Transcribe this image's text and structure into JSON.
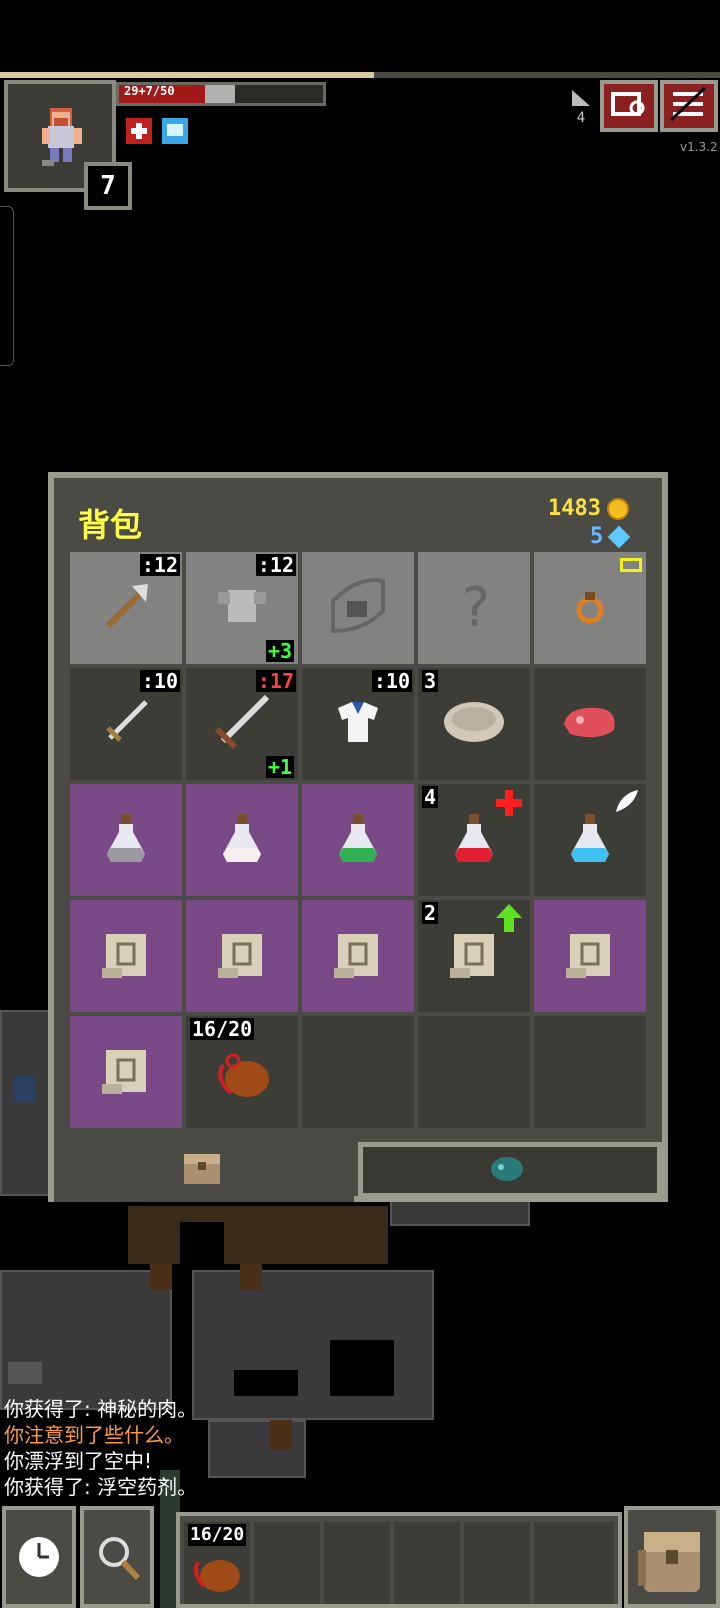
{
  "hud": {
    "hp_text": "29+7/50",
    "hero_level": "7",
    "depth": "4",
    "version": "v1.3.2",
    "experience_fraction": 0.52,
    "hp_fraction": 0.58,
    "shield_fraction": 0.14
  },
  "backpack": {
    "title": "背包",
    "gold": "1483",
    "gems": "5",
    "slots": [
      {
        "name": "axe",
        "level": ":12",
        "bonus": "",
        "qty": "",
        "bg": "light",
        "icon": "axe-icon"
      },
      {
        "name": "chain-armor",
        "level": ":12",
        "bonus": "+3",
        "qty": "",
        "bg": "light",
        "icon": "armor-icon"
      },
      {
        "name": "empty-artifact-slot",
        "level": "",
        "bonus": "",
        "qty": "",
        "bg": "light",
        "icon": "artifact-placeholder-icon"
      },
      {
        "name": "empty-misc-slot",
        "level": "",
        "bonus": "",
        "qty": "",
        "bg": "light",
        "icon": "question-icon"
      },
      {
        "name": "ring",
        "level": "",
        "bonus": "",
        "qty": "",
        "bg": "light",
        "icon": "ring-icon"
      },
      {
        "name": "dagger",
        "level": ":10",
        "bonus": "",
        "qty": "",
        "bg": "dark",
        "icon": "dagger-icon"
      },
      {
        "name": "sword",
        "level": ":17",
        "bonus": "+1",
        "qty": "",
        "bg": "dark",
        "icon": "sword-icon",
        "level_red": true
      },
      {
        "name": "cloth-armor",
        "level": ":10",
        "bonus": "",
        "qty": "",
        "bg": "dark",
        "icon": "shirt-icon"
      },
      {
        "name": "stone",
        "level": "",
        "bonus": "",
        "qty": "3",
        "bg": "dark",
        "icon": "stone-icon"
      },
      {
        "name": "meat",
        "level": "",
        "bonus": "",
        "qty": "",
        "bg": "dark",
        "icon": "meat-icon"
      },
      {
        "name": "potion-grey",
        "level": "",
        "bonus": "",
        "qty": "",
        "bg": "purple",
        "icon": "potion-grey-icon"
      },
      {
        "name": "potion-white",
        "level": "",
        "bonus": "",
        "qty": "",
        "bg": "purple",
        "icon": "potion-white-icon"
      },
      {
        "name": "potion-green",
        "level": "",
        "bonus": "",
        "qty": "",
        "bg": "purple",
        "icon": "potion-green-icon"
      },
      {
        "name": "potion-healing",
        "level": "",
        "bonus": "",
        "qty": "4",
        "bg": "dark",
        "icon": "potion-red-icon"
      },
      {
        "name": "potion-levitation",
        "level": "",
        "bonus": "",
        "qty": "",
        "bg": "dark",
        "icon": "potion-cyan-icon"
      },
      {
        "name": "scroll-1",
        "level": "",
        "bonus": "",
        "qty": "",
        "bg": "purple",
        "icon": "scroll-icon"
      },
      {
        "name": "scroll-2",
        "level": "",
        "bonus": "",
        "qty": "",
        "bg": "purple",
        "icon": "scroll-icon"
      },
      {
        "name": "scroll-3",
        "level": "",
        "bonus": "",
        "qty": "",
        "bg": "purple",
        "icon": "scroll-icon"
      },
      {
        "name": "scroll-upgrade",
        "level": "",
        "bonus": "",
        "qty": "2",
        "bg": "dark",
        "icon": "scroll-icon"
      },
      {
        "name": "scroll-5",
        "level": "",
        "bonus": "",
        "qty": "",
        "bg": "purple",
        "icon": "scroll-icon"
      },
      {
        "name": "scroll-6",
        "level": "",
        "bonus": "",
        "qty": "",
        "bg": "purple",
        "icon": "scroll-icon"
      },
      {
        "name": "waterskin",
        "level": "",
        "bonus": "",
        "qty": "16/20",
        "bg": "dark",
        "icon": "waterskin-icon"
      },
      {
        "name": "empty-1",
        "level": "",
        "bonus": "",
        "qty": "",
        "bg": "dark",
        "icon": ""
      },
      {
        "name": "empty-2",
        "level": "",
        "bonus": "",
        "qty": "",
        "bg": "dark",
        "icon": ""
      },
      {
        "name": "empty-3",
        "level": "",
        "bonus": "",
        "qty": "",
        "bg": "dark",
        "icon": ""
      }
    ]
  },
  "log": [
    {
      "text": "你获得了: 神秘的肉。",
      "type": "normal"
    },
    {
      "text": "你注意到了些什么。",
      "type": "warn"
    },
    {
      "text": "你漂浮到了空中!",
      "type": "normal"
    },
    {
      "text": "你获得了: 浮空药剂。",
      "type": "normal"
    }
  ],
  "quickslot": {
    "qty": "16/20"
  },
  "colors": {
    "panel": "#4b4b45",
    "border": "#9a9a8e",
    "title": "#ffff44",
    "gold": "#ffe040",
    "gem": "#6cb8ff",
    "hp": "#a01818",
    "purple_slot": "#7a4a86",
    "warn_text": "#ff9c3a"
  }
}
